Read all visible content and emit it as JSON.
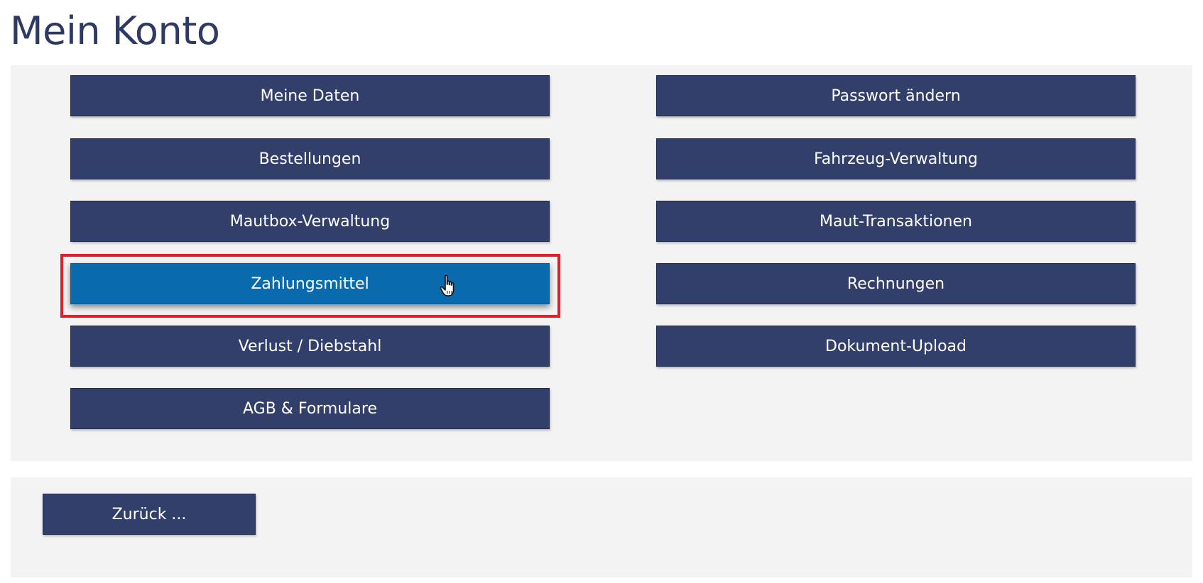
{
  "page": {
    "title": "Mein Konto"
  },
  "menu": {
    "left": [
      {
        "label": "Meine Daten"
      },
      {
        "label": "Bestellungen"
      },
      {
        "label": "Mautbox-Verwaltung"
      },
      {
        "label": "Zahlungsmittel",
        "state": "hover"
      },
      {
        "label": "Verlust / Diebstahl"
      },
      {
        "label": "AGB & Formulare"
      }
    ],
    "right": [
      {
        "label": "Passwort ändern"
      },
      {
        "label": "Fahrzeug-Verwaltung"
      },
      {
        "label": "Maut-Transaktionen"
      },
      {
        "label": "Rechnungen"
      },
      {
        "label": "Dokument-Upload"
      }
    ]
  },
  "footer": {
    "back_label": "Zurück ..."
  },
  "colors": {
    "title": "#2d3a66",
    "button": "#323f6b",
    "button_active": "#0a6aae",
    "highlight": "#e0202a",
    "panel": "#f3f3f3"
  },
  "icons": {
    "cursor": "hand-pointer-icon"
  }
}
